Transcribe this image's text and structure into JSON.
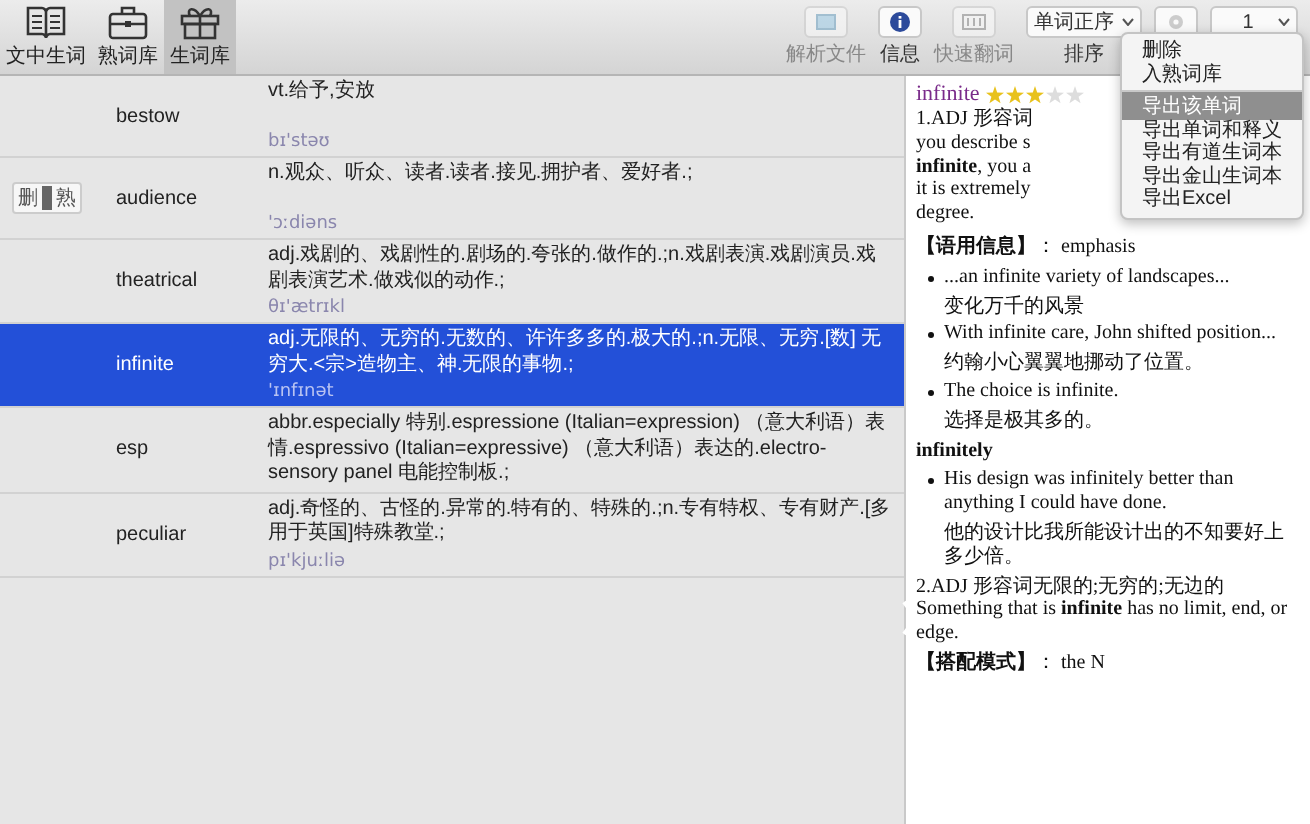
{
  "toolbar": {
    "left": [
      {
        "kind": "book",
        "label": "文中生词",
        "selected": false
      },
      {
        "kind": "briefcase",
        "label": "熟词库",
        "selected": false
      },
      {
        "kind": "gift",
        "label": "生词库",
        "selected": true
      }
    ],
    "right": [
      {
        "kind": "file",
        "label": "解析文件",
        "disabled": true
      },
      {
        "kind": "info",
        "label": "信息",
        "disabled": false
      },
      {
        "kind": "translate",
        "label": "快速翻词",
        "disabled": true
      },
      {
        "kind": "sort",
        "label": "排序",
        "value": "单词正序",
        "disabled": false
      },
      {
        "kind": "settings",
        "disabled": false
      },
      {
        "kind": "page",
        "value": "1",
        "disabled": false
      }
    ]
  },
  "words": [
    {
      "word": "bestow",
      "definition": "vt.给予,安放",
      "phonetic": "bɪ'stəʊ",
      "selected": false
    },
    {
      "word": "audience",
      "definition": "n.观众、听众、读者.读者.接见.拥护者、爱好者.;",
      "phonetic": "'ɔːdiəns",
      "selected": false,
      "toggle": {
        "left": "删",
        "right": "熟"
      }
    },
    {
      "word": "theatrical",
      "definition": "adj.戏剧的、戏剧性的.剧场的.夸张的.做作的.;n.戏剧表演.戏剧演员.戏剧表演艺术.做戏似的动作.;",
      "phonetic": "θɪ'ætrɪkl",
      "selected": false
    },
    {
      "word": "infinite",
      "definition": "adj.无限的、无穷的.无数的、许许多多的.极大的.;n.无限、无穷.[数] 无穷大.<宗>造物主、神.无限的事物.;",
      "phonetic": "'ɪnfɪnət",
      "selected": true
    },
    {
      "word": "esp",
      "definition": "abbr.especially 特别.espressione (Italian=expression) （意大利语）表情.espressivo (Italian=expressive) （意大利语）表达的.electro-sensory panel 电能控制板.;",
      "selected": false
    },
    {
      "word": "peculiar",
      "definition": "adj.奇怪的、古怪的.异常的.特有的、特殊的.;n.专有特权、专有财产.[多用于英国]特殊教堂.;",
      "phonetic": "pɪ'kjuːliə",
      "selected": false
    }
  ],
  "detail": [
    {
      "kind": "head",
      "word": "infinite",
      "stars": 3
    },
    {
      "kind": "lines",
      "lines": [
        "1.ADJ 形容词",
        "you describe s",
        "**infinite**, you a",
        "it is extremely",
        "degree."
      ]
    },
    {
      "kind": "section",
      "text": "**【语用信息】**： emphasis"
    },
    {
      "kind": "example",
      "en": "...an infinite variety of landscapes...",
      "zh": "变化万千的风景"
    },
    {
      "kind": "example",
      "en": "With infinite care, John shifted position...",
      "zh": "约翰小心翼翼地挪动了位置。"
    },
    {
      "kind": "example",
      "en": "The choice is infinite.",
      "zh": "选择是极其多的。"
    },
    {
      "kind": "subhead",
      "text": "infinitely"
    },
    {
      "kind": "example",
      "en": "His design was infinitely better than anything I could have done.",
      "zh": "他的设计比我所能设计出的不知要好上多少倍。"
    },
    {
      "kind": "para",
      "text": "2.ADJ 形容词无限的;无穷的;无边的 Something that is **infinite** has no limit, end, or edge."
    },
    {
      "kind": "section",
      "text": "**【搭配模式】**： the N"
    }
  ],
  "menu": [
    {
      "label": "删除",
      "selected": false,
      "divider_before": false
    },
    {
      "label": "入熟词库",
      "selected": false,
      "divider_before": false
    },
    {
      "label": "导出该单词",
      "selected": true,
      "divider_before": true
    },
    {
      "label": "导出单词和释义",
      "selected": false,
      "divider_before": false
    },
    {
      "label": "导出有道生词本",
      "selected": false,
      "divider_before": false
    },
    {
      "label": "导出金山生词本",
      "selected": false,
      "divider_before": false
    },
    {
      "label": "导出Excel",
      "selected": false,
      "divider_before": false
    }
  ]
}
